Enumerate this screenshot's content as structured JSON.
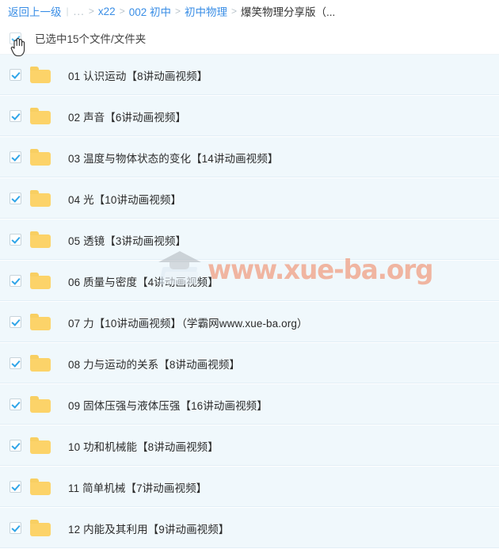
{
  "breadcrumb": {
    "back_label": "返回上一级",
    "ellipsis": "...",
    "separator": ">",
    "divider": "|",
    "items": [
      {
        "label": "x22",
        "current": false
      },
      {
        "label": "002 初中",
        "current": false
      },
      {
        "label": "初中物理",
        "current": false
      },
      {
        "label": "爆笑物理分享版（...",
        "current": true
      }
    ]
  },
  "toolbar": {
    "select_all_checked": true,
    "selection_label": "已选中15个文件/文件夹"
  },
  "colors": {
    "link": "#3a8ee6",
    "row_selected_bg": "#f0f8fc",
    "row_border": "#e2eef6",
    "folder": "#fcd369",
    "checkbox_check": "#30a5e8",
    "text": "#2b2b2b",
    "watermark": "#f08c69"
  },
  "watermark": {
    "text": "www.xue-ba.org",
    "logo": "graduation-cap-book-logo"
  },
  "files": [
    {
      "checked": true,
      "icon": "folder-icon",
      "name": "01 认识运动【8讲动画视频】"
    },
    {
      "checked": true,
      "icon": "folder-icon",
      "name": "02 声音【6讲动画视频】"
    },
    {
      "checked": true,
      "icon": "folder-icon",
      "name": "03 温度与物体状态的变化【14讲动画视频】"
    },
    {
      "checked": true,
      "icon": "folder-icon",
      "name": "04 光【10讲动画视频】"
    },
    {
      "checked": true,
      "icon": "folder-icon",
      "name": "05 透镜【3讲动画视频】"
    },
    {
      "checked": true,
      "icon": "folder-icon",
      "name": "06 质量与密度【4讲动画视频】"
    },
    {
      "checked": true,
      "icon": "folder-icon",
      "name": "07 力【10讲动画视频】（学霸网www.xue-ba.org）"
    },
    {
      "checked": true,
      "icon": "folder-icon",
      "name": "08 力与运动的关系【8讲动画视频】"
    },
    {
      "checked": true,
      "icon": "folder-icon",
      "name": "09 固体压强与液体压强【16讲动画视频】"
    },
    {
      "checked": true,
      "icon": "folder-icon",
      "name": "10 功和机械能【8讲动画视频】"
    },
    {
      "checked": true,
      "icon": "folder-icon",
      "name": "11 简单机械【7讲动画视频】"
    },
    {
      "checked": true,
      "icon": "folder-icon",
      "name": "12 内能及其利用【9讲动画视频】"
    }
  ]
}
